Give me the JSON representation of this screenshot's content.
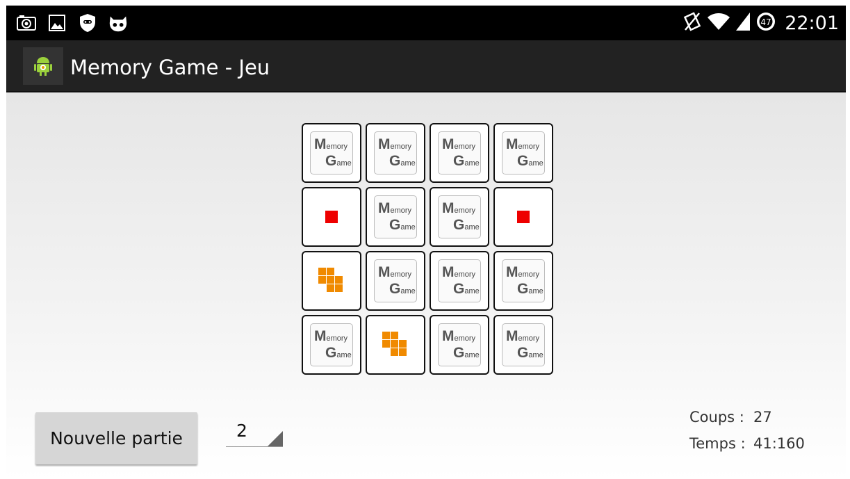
{
  "status_bar": {
    "left_icons": [
      "camera-icon",
      "image-icon",
      "shield-icon",
      "cyanogen-mascot-icon"
    ],
    "right_icons": [
      "no-vibrate-icon",
      "wifi-icon",
      "signal-icon"
    ],
    "battery_level": "47",
    "time": "22:01"
  },
  "action_bar": {
    "app_icon": "android-icon",
    "title": "Memory Game - Jeu"
  },
  "card_back": {
    "letter1": "M",
    "rest1": "emory",
    "letter2": "G",
    "rest2": "ame"
  },
  "board": {
    "rows": 4,
    "cols": 4,
    "cards": [
      "back",
      "back",
      "back",
      "back",
      "red-square",
      "back",
      "back",
      "red-square",
      "orange-blocks",
      "back",
      "back",
      "back",
      "back",
      "orange-blocks",
      "back",
      "back"
    ]
  },
  "controls": {
    "new_game_label": "Nouvelle partie",
    "spinner_value": "2"
  },
  "stats": {
    "moves_label": "Coups :",
    "moves_value": "27",
    "time_label": "Temps :",
    "time_value": "41:160"
  },
  "colors": {
    "red_card": "#ee0000",
    "orange_card": "#f08a00"
  }
}
